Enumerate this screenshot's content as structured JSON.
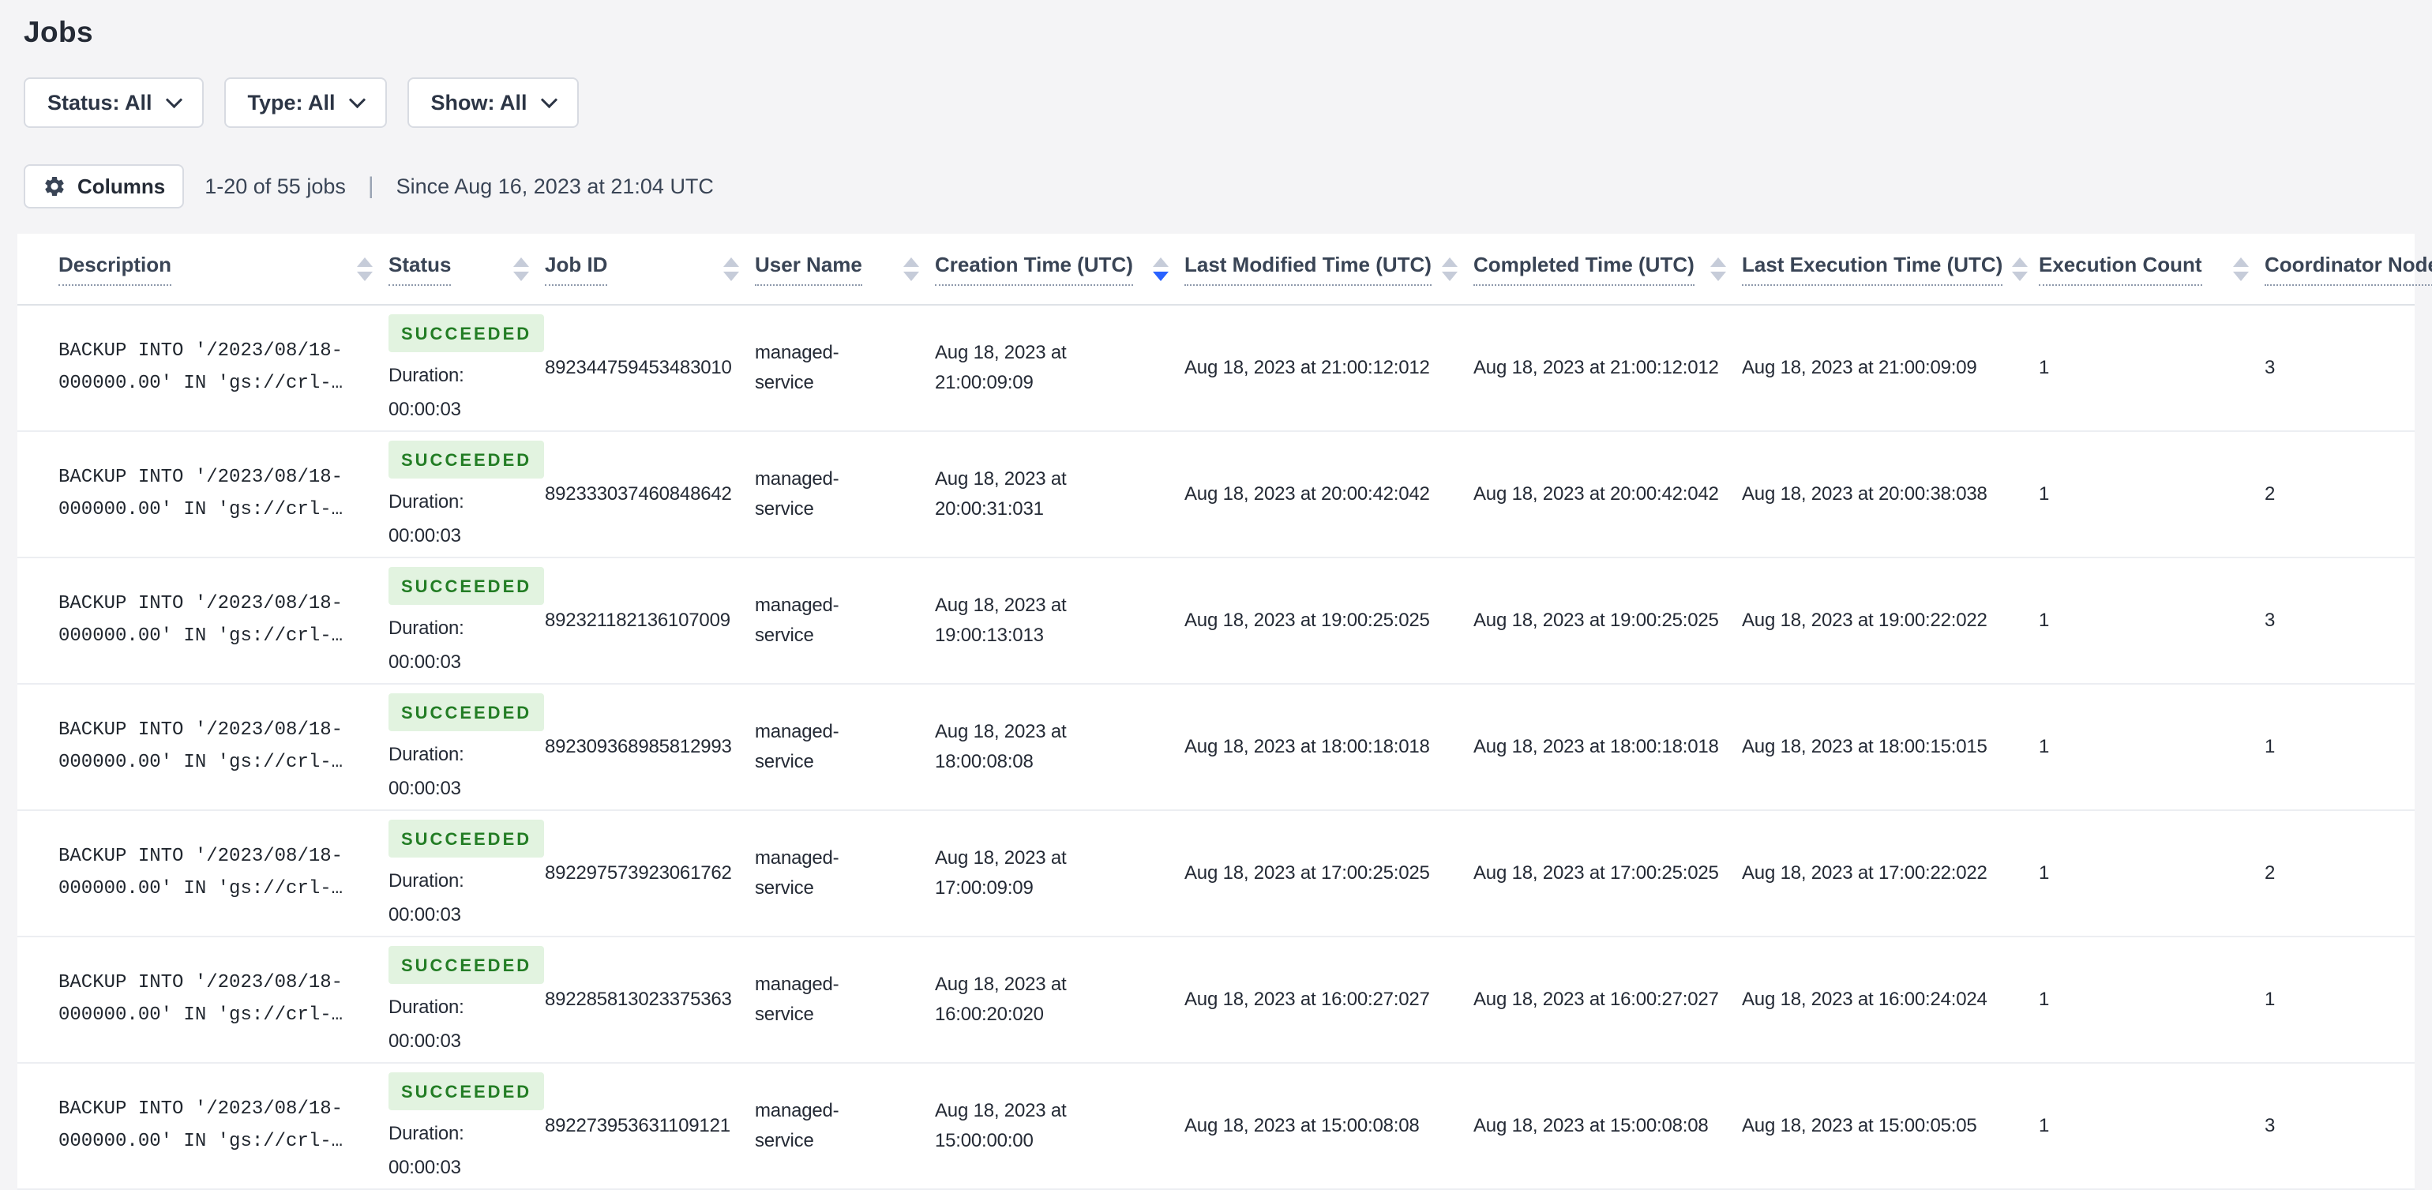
{
  "page": {
    "title": "Jobs"
  },
  "filters": [
    {
      "label": "Status: All",
      "icon": "chevron-down-icon"
    },
    {
      "label": "Type: All",
      "icon": "chevron-down-icon"
    },
    {
      "label": "Show: All",
      "icon": "chevron-down-icon"
    }
  ],
  "toolbar": {
    "columns_button": "Columns",
    "columns_icon": "gear-icon",
    "results_count": "1-20 of 55 jobs",
    "divider": "|",
    "since": "Since Aug 16, 2023 at 21:04 UTC"
  },
  "colors": {
    "page_bg": "#f4f4f6",
    "text_primary": "#242a35",
    "text_secondary": "#394455",
    "sort_active_blue": "#2962ff",
    "badge_green_bg": "#e2f3e0",
    "badge_green_text": "#237d25",
    "row_divider": "#eceef2"
  },
  "table": {
    "columns": [
      {
        "label": "Description",
        "sort": "none"
      },
      {
        "label": "Status",
        "sort": "none"
      },
      {
        "label": "Job ID",
        "sort": "none"
      },
      {
        "label": "User Name",
        "sort": "none"
      },
      {
        "label": "Creation Time (UTC)",
        "sort": "desc"
      },
      {
        "label": "Last Modified Time (UTC)",
        "sort": "none"
      },
      {
        "label": "Completed Time (UTC)",
        "sort": "none"
      },
      {
        "label": "Last Execution Time (UTC)",
        "sort": "none"
      },
      {
        "label": "Execution Count",
        "sort": "none"
      },
      {
        "label": "Coordinator Node",
        "sort": "none"
      }
    ],
    "rows": [
      {
        "description": "BACKUP INTO '/2023/08/18-000000.00' IN 'gs://crl-…",
        "status": "SUCCEEDED",
        "duration_label": "Duration:",
        "duration": "00:00:03",
        "job_id": "892344759453483010",
        "user_name": "managed-service",
        "creation_time": "Aug 18, 2023 at 21:00:09:09",
        "last_modified_time": "Aug 18, 2023 at 21:00:12:012",
        "completed_time": "Aug 18, 2023 at 21:00:12:012",
        "last_execution_time": "Aug 18, 2023 at 21:00:09:09",
        "execution_count": "1",
        "coordinator_node": "3"
      },
      {
        "description": "BACKUP INTO '/2023/08/18-000000.00' IN 'gs://crl-…",
        "status": "SUCCEEDED",
        "duration_label": "Duration:",
        "duration": "00:00:03",
        "job_id": "892333037460848642",
        "user_name": "managed-service",
        "creation_time": "Aug 18, 2023 at 20:00:31:031",
        "last_modified_time": "Aug 18, 2023 at 20:00:42:042",
        "completed_time": "Aug 18, 2023 at 20:00:42:042",
        "last_execution_time": "Aug 18, 2023 at 20:00:38:038",
        "execution_count": "1",
        "coordinator_node": "2"
      },
      {
        "description": "BACKUP INTO '/2023/08/18-000000.00' IN 'gs://crl-…",
        "status": "SUCCEEDED",
        "duration_label": "Duration:",
        "duration": "00:00:03",
        "job_id": "892321182136107009",
        "user_name": "managed-service",
        "creation_time": "Aug 18, 2023 at 19:00:13:013",
        "last_modified_time": "Aug 18, 2023 at 19:00:25:025",
        "completed_time": "Aug 18, 2023 at 19:00:25:025",
        "last_execution_time": "Aug 18, 2023 at 19:00:22:022",
        "execution_count": "1",
        "coordinator_node": "3"
      },
      {
        "description": "BACKUP INTO '/2023/08/18-000000.00' IN 'gs://crl-…",
        "status": "SUCCEEDED",
        "duration_label": "Duration:",
        "duration": "00:00:03",
        "job_id": "892309368985812993",
        "user_name": "managed-service",
        "creation_time": "Aug 18, 2023 at 18:00:08:08",
        "last_modified_time": "Aug 18, 2023 at 18:00:18:018",
        "completed_time": "Aug 18, 2023 at 18:00:18:018",
        "last_execution_time": "Aug 18, 2023 at 18:00:15:015",
        "execution_count": "1",
        "coordinator_node": "1"
      },
      {
        "description": "BACKUP INTO '/2023/08/18-000000.00' IN 'gs://crl-…",
        "status": "SUCCEEDED",
        "duration_label": "Duration:",
        "duration": "00:00:03",
        "job_id": "892297573923061762",
        "user_name": "managed-service",
        "creation_time": "Aug 18, 2023 at 17:00:09:09",
        "last_modified_time": "Aug 18, 2023 at 17:00:25:025",
        "completed_time": "Aug 18, 2023 at 17:00:25:025",
        "last_execution_time": "Aug 18, 2023 at 17:00:22:022",
        "execution_count": "1",
        "coordinator_node": "2"
      },
      {
        "description": "BACKUP INTO '/2023/08/18-000000.00' IN 'gs://crl-…",
        "status": "SUCCEEDED",
        "duration_label": "Duration:",
        "duration": "00:00:03",
        "job_id": "892285813023375363",
        "user_name": "managed-service",
        "creation_time": "Aug 18, 2023 at 16:00:20:020",
        "last_modified_time": "Aug 18, 2023 at 16:00:27:027",
        "completed_time": "Aug 18, 2023 at 16:00:27:027",
        "last_execution_time": "Aug 18, 2023 at 16:00:24:024",
        "execution_count": "1",
        "coordinator_node": "1"
      },
      {
        "description": "BACKUP INTO '/2023/08/18-000000.00' IN 'gs://crl-…",
        "status": "SUCCEEDED",
        "duration_label": "Duration:",
        "duration": "00:00:03",
        "job_id": "892273953631109121",
        "user_name": "managed-service",
        "creation_time": "Aug 18, 2023 at 15:00:00:00",
        "last_modified_time": "Aug 18, 2023 at 15:00:08:08",
        "completed_time": "Aug 18, 2023 at 15:00:08:08",
        "last_execution_time": "Aug 18, 2023 at 15:00:05:05",
        "execution_count": "1",
        "coordinator_node": "3"
      }
    ]
  }
}
